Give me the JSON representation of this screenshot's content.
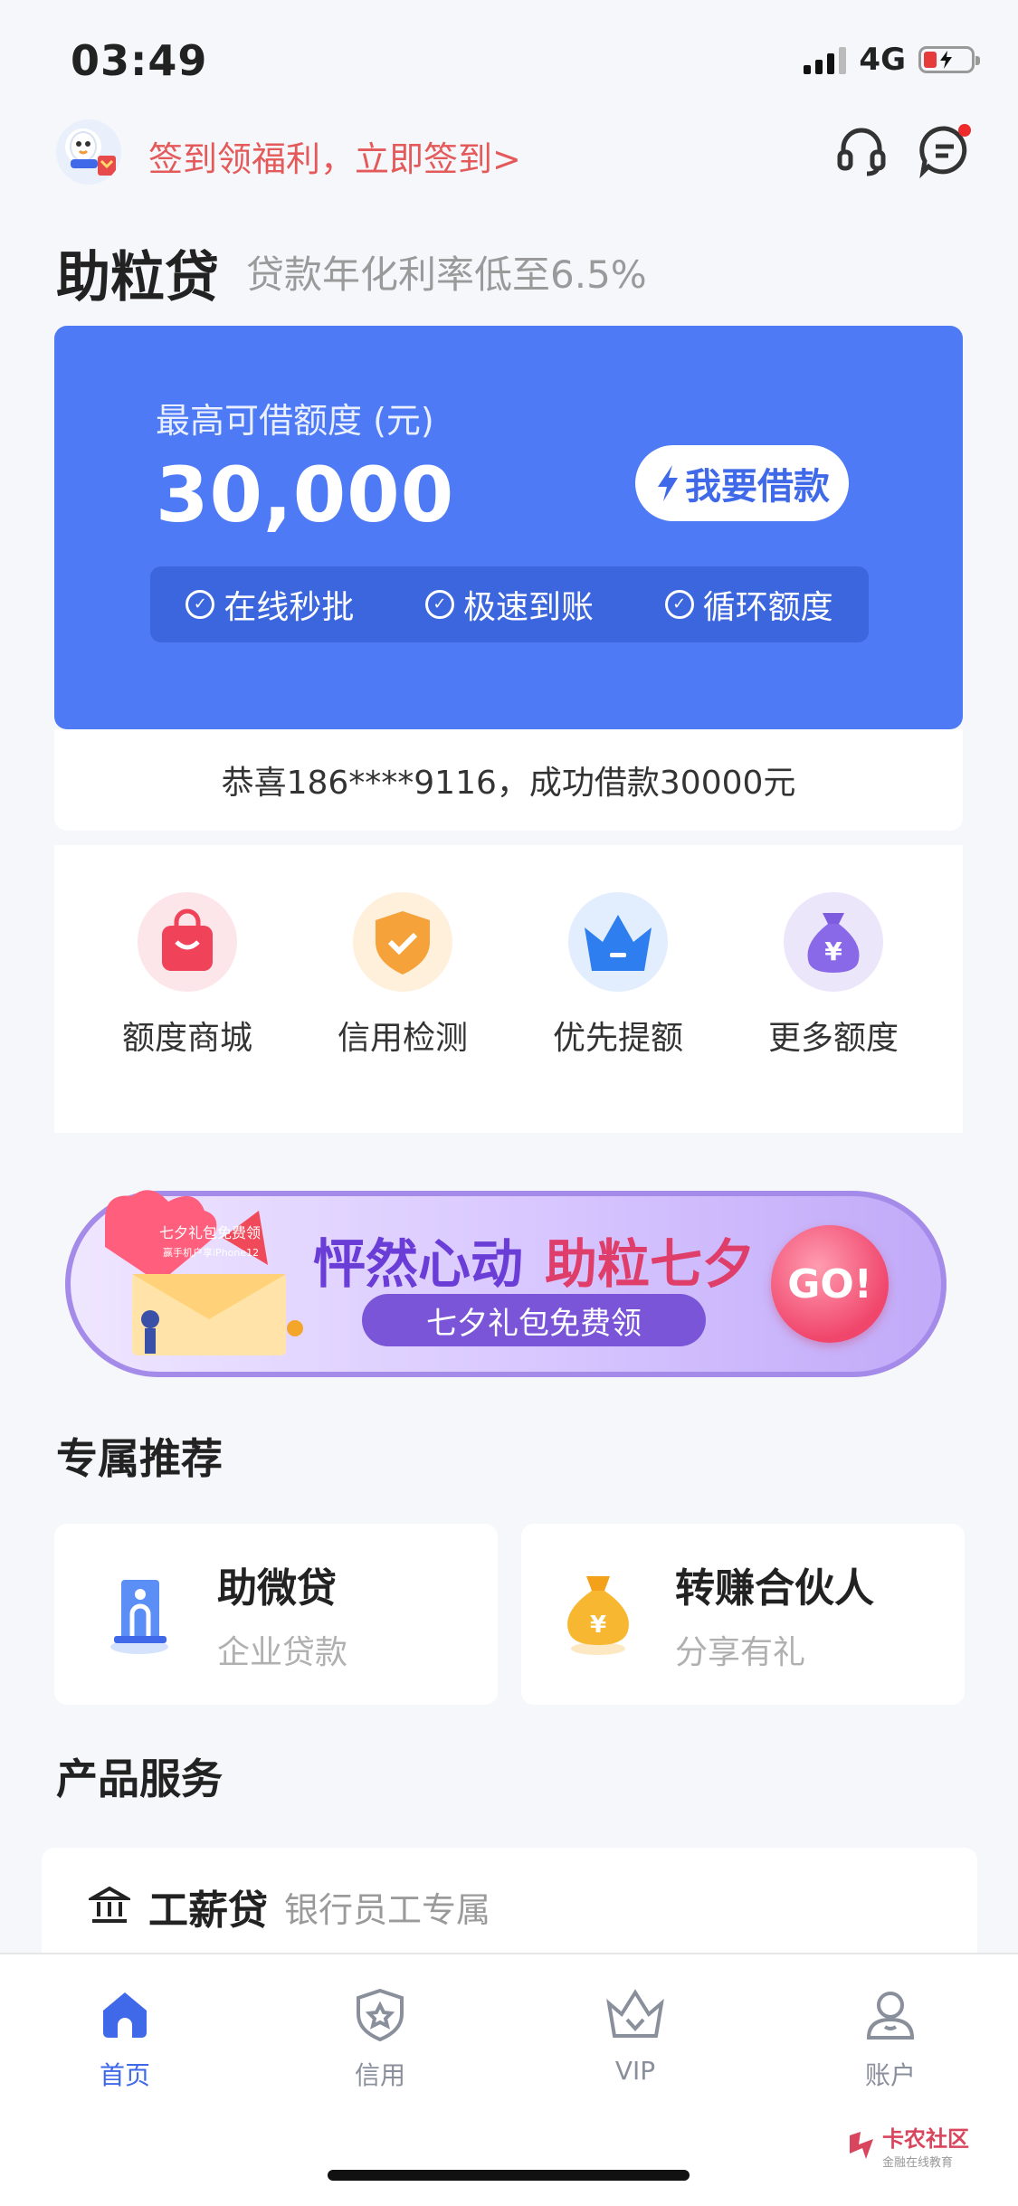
{
  "status_bar": {
    "time": "03:49",
    "network": "4G"
  },
  "header": {
    "signin_text": "签到领福利，立即签到>"
  },
  "brand": {
    "title": "助粒贷",
    "subtitle": "贷款年化利率低至6.5%"
  },
  "credit_card": {
    "limit_label": "最高可借额度 (元)",
    "limit_value": "30,000",
    "borrow_button": "我要借款",
    "features": [
      "在线秒批",
      "极速到账",
      "循环额度"
    ]
  },
  "notice": "恭喜186****9116，成功借款30000元",
  "quick_tiles": [
    {
      "label": "额度商城",
      "icon": "shopping-bag-icon"
    },
    {
      "label": "信用检测",
      "icon": "shield-check-icon"
    },
    {
      "label": "优先提额",
      "icon": "crown-icon"
    },
    {
      "label": "更多额度",
      "icon": "money-bag-icon"
    }
  ],
  "banner": {
    "title_a": "怦然心动",
    "title_b": "助粒七夕",
    "pill": "七夕礼包免费领",
    "go": "GO!",
    "gift_line1": "七夕礼包免费领",
    "gift_line2": "赢手机户享iPhone12"
  },
  "recommend": {
    "title": "专属推荐",
    "items": [
      {
        "title": "助微贷",
        "sub": "企业贷款"
      },
      {
        "title": "转赚合伙人",
        "sub": "分享有礼"
      }
    ]
  },
  "products": {
    "title": "产品服务",
    "items": [
      {
        "title": "工薪贷",
        "sub": "银行员工专属"
      }
    ]
  },
  "tabs": [
    {
      "label": "首页",
      "active": true
    },
    {
      "label": "信用",
      "active": false
    },
    {
      "label": "VIP",
      "active": false
    },
    {
      "label": "账户",
      "active": false
    }
  ],
  "watermark": {
    "title": "卡农社区",
    "sub": "金融在线教育"
  },
  "colors": {
    "primary": "#4e7af5",
    "accent_red": "#e45a5a",
    "tab_active": "#3f69e8"
  }
}
